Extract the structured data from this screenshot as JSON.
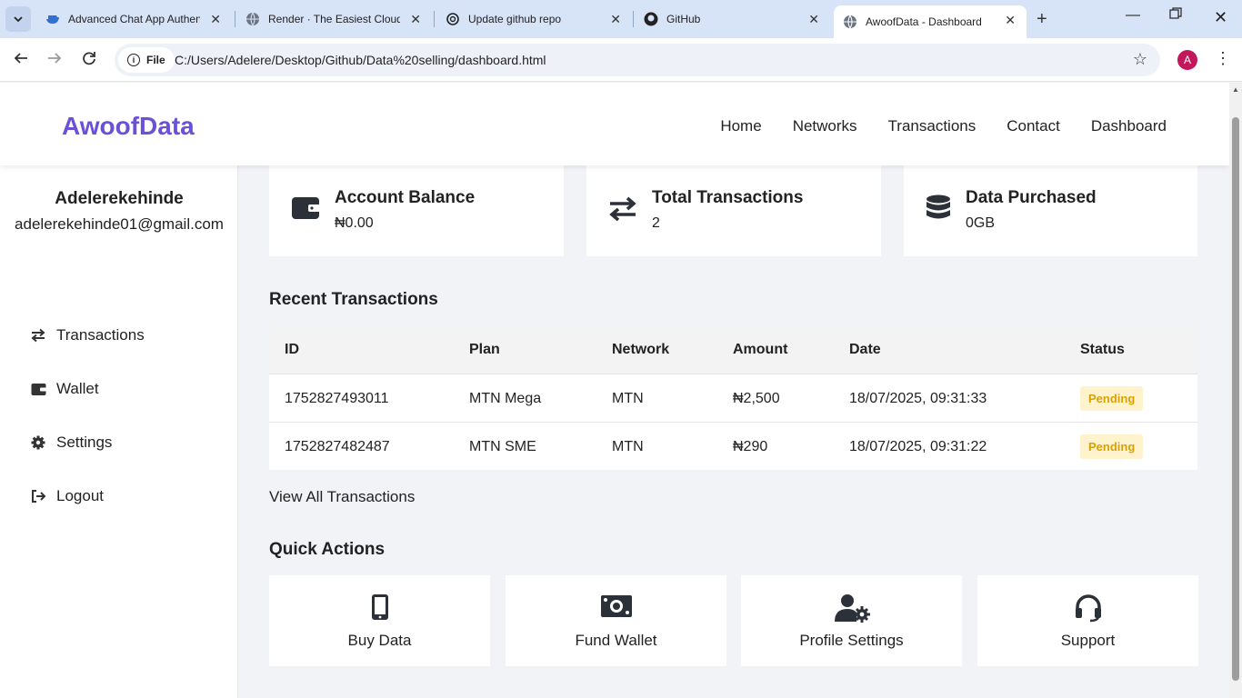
{
  "browser": {
    "tabs": [
      {
        "title": "Advanced Chat App Authenti",
        "icon": "docker-whale-icon"
      },
      {
        "title": "Render · The Easiest Cloud F",
        "icon": "globe-icon"
      },
      {
        "title": "Update github repo",
        "icon": "openai-icon"
      },
      {
        "title": "GitHub",
        "icon": "github-icon"
      },
      {
        "title": "AwoofData - Dashboard",
        "icon": "globe-icon"
      }
    ],
    "address_chip": "File",
    "url": "C:/Users/Adelere/Desktop/Github/Data%20selling/dashboard.html",
    "profile_initial": "A"
  },
  "site": {
    "brand": "AwoofData",
    "brand_color": "#6b50d8",
    "nav": [
      "Home",
      "Networks",
      "Transactions",
      "Contact",
      "Dashboard"
    ]
  },
  "user": {
    "name": "Adelerekehinde",
    "email": "adelerekehinde01@gmail.com"
  },
  "sidebar": {
    "items": [
      {
        "label": "Transactions",
        "icon": "exchange-icon"
      },
      {
        "label": "Wallet",
        "icon": "wallet-icon"
      },
      {
        "label": "Settings",
        "icon": "gear-icon"
      },
      {
        "label": "Logout",
        "icon": "logout-icon"
      }
    ]
  },
  "stats": [
    {
      "label": "Account Balance",
      "value": "₦0.00",
      "icon": "wallet-icon"
    },
    {
      "label": "Total Transactions",
      "value": "2",
      "icon": "exchange-icon"
    },
    {
      "label": "Data Purchased",
      "value": "0GB",
      "icon": "database-icon"
    }
  ],
  "recent": {
    "title": "Recent Transactions",
    "headers": [
      "ID",
      "Plan",
      "Network",
      "Amount",
      "Date",
      "Status"
    ],
    "rows": [
      {
        "id": "1752827493011",
        "plan": "MTN Mega",
        "network": "MTN",
        "amount": "₦2,500",
        "date": "18/07/2025, 09:31:33",
        "status": "Pending"
      },
      {
        "id": "1752827482487",
        "plan": "MTN SME",
        "network": "MTN",
        "amount": "₦290",
        "date": "18/07/2025, 09:31:22",
        "status": "Pending"
      }
    ],
    "view_all": "View All Transactions",
    "status_color": "#d8a106"
  },
  "quick_actions": {
    "title": "Quick Actions",
    "items": [
      {
        "label": "Buy Data",
        "icon": "mobile-icon"
      },
      {
        "label": "Fund Wallet",
        "icon": "money-bill-icon"
      },
      {
        "label": "Profile Settings",
        "icon": "user-gear-icon"
      },
      {
        "label": "Support",
        "icon": "headset-icon"
      }
    ]
  }
}
